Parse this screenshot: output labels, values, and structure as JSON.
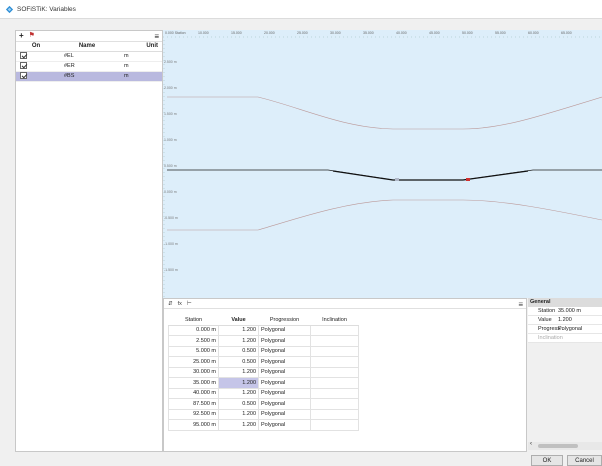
{
  "window": {
    "title": "SOFiSTiK: Variables"
  },
  "left_panel": {
    "toolbar": {
      "add_icon": "+",
      "flag_icon": "⚑",
      "menu_icon": "≡"
    },
    "columns": [
      "On",
      "Name",
      "Unit"
    ],
    "rows": [
      {
        "name": "#EL",
        "unit": "m",
        "checked": true,
        "selected": false
      },
      {
        "name": "#ER",
        "unit": "m",
        "checked": true,
        "selected": false
      },
      {
        "name": "#BS",
        "unit": "m",
        "checked": true,
        "selected": true
      }
    ]
  },
  "graph": {
    "x_ticks": [
      "0.000 Station",
      "10.000",
      "15.000",
      "20.000",
      "25.000",
      "30.000",
      "35.000",
      "40.000",
      "45.000",
      "50.000",
      "55.000",
      "60.000",
      "65.000"
    ],
    "y_labels": [
      "2.500 m",
      "2.000 m",
      "1.500 m",
      "1.000 m",
      "0.500 m",
      "0.000 m",
      "-0.500 m",
      "-1.000 m",
      "-1.500 m"
    ]
  },
  "table_panel": {
    "toolbar": {
      "icon1": "⇵",
      "icon2": "fx",
      "icon3": "⊢",
      "menu_icon": "≡"
    },
    "columns": [
      "Station",
      "Value",
      "Progression",
      "Inclination"
    ],
    "rows": [
      {
        "station": "0.000 m",
        "value": "1.200",
        "progression": "Polygonal",
        "inclination": ""
      },
      {
        "station": "2.500 m",
        "value": "1.200",
        "progression": "Polygonal",
        "inclination": ""
      },
      {
        "station": "5.000 m",
        "value": "0.500",
        "progression": "Polygonal",
        "inclination": ""
      },
      {
        "station": "25.000 m",
        "value": "0.500",
        "progression": "Polygonal",
        "inclination": ""
      },
      {
        "station": "30.000 m",
        "value": "1.200",
        "progression": "Polygonal",
        "inclination": ""
      },
      {
        "station": "35.000 m",
        "value": "1.200",
        "progression": "Polygonal",
        "inclination": ""
      },
      {
        "station": "40.000 m",
        "value": "1.200",
        "progression": "Polygonal",
        "inclination": ""
      },
      {
        "station": "87.500 m",
        "value": "0.500",
        "progression": "Polygonal",
        "inclination": ""
      },
      {
        "station": "92.500 m",
        "value": "1.200",
        "progression": "Polygonal",
        "inclination": ""
      },
      {
        "station": "95.000 m",
        "value": "1.200",
        "progression": "Polygonal",
        "inclination": ""
      }
    ],
    "selected_row": 5
  },
  "properties": {
    "group": "General",
    "rows": [
      {
        "key": "Station",
        "value": "35.000 m",
        "dim": false
      },
      {
        "key": "Value",
        "value": "1.200",
        "dim": false
      },
      {
        "key": "Progress...",
        "value": "Polygonal",
        "dim": false
      },
      {
        "key": "Inclination",
        "value": "",
        "dim": true
      }
    ],
    "scroll_left_icon": "‹"
  },
  "buttons": {
    "ok": "OK",
    "cancel": "Cancel"
  },
  "colors": {
    "graph_bg": "#ddeefa",
    "selection": "#b9b9df",
    "accent_point": "#d03030"
  }
}
